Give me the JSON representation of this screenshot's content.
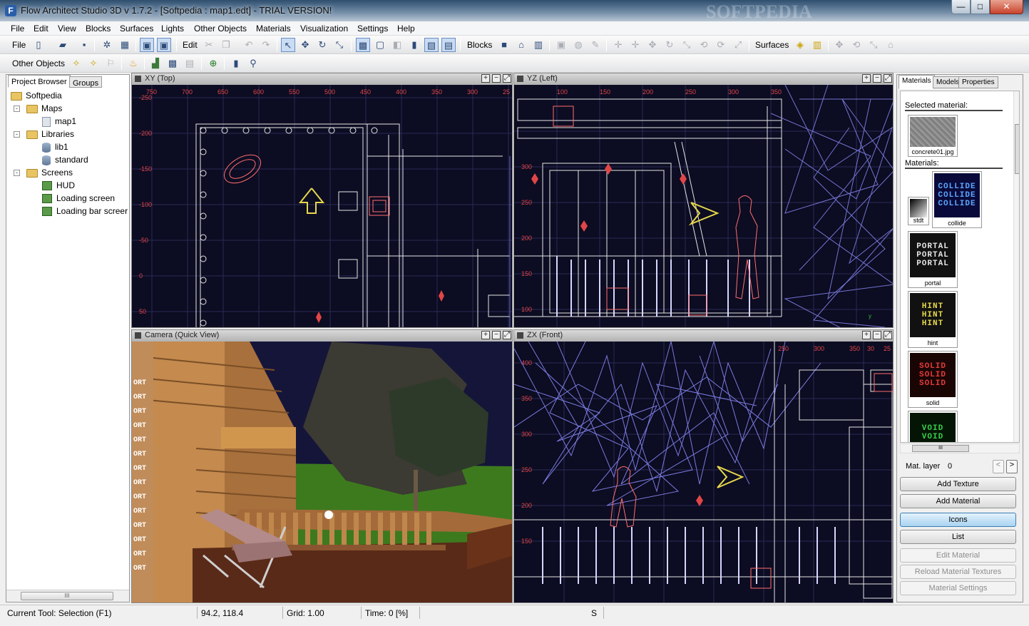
{
  "window": {
    "title": "Flow Architect Studio 3D v 1.7.2  - [Softpedia : map1.edt]  - TRIAL VERSION!",
    "watermark": "SOFTPEDIA",
    "app_icon": "F",
    "min_label": "—",
    "max_label": "□",
    "close_label": "✕"
  },
  "menu": [
    "File",
    "Edit",
    "View",
    "Blocks",
    "Surfaces",
    "Lights",
    "Other Objects",
    "Materials",
    "Visualization",
    "Settings",
    "Help"
  ],
  "toolbar1": {
    "file_label": "File",
    "edit_label": "Edit",
    "blocks_label": "Blocks",
    "surfaces_label": "Surfaces"
  },
  "toolbar2": {
    "other_objects_label": "Other Objects"
  },
  "left_panel": {
    "tabs": [
      "Project Browser",
      "Groups"
    ],
    "tree": [
      {
        "label": "Softpedia",
        "level": 0,
        "icon": "folder-icon"
      },
      {
        "label": "Maps",
        "level": 1,
        "icon": "folder-icon",
        "expander": "-"
      },
      {
        "label": "map1",
        "level": 2,
        "icon": "map-file-icon"
      },
      {
        "label": "Libraries",
        "level": 1,
        "icon": "folder-icon",
        "expander": "-"
      },
      {
        "label": "lib1",
        "level": 2,
        "icon": "library-icon"
      },
      {
        "label": "standard",
        "level": 2,
        "icon": "library-icon"
      },
      {
        "label": "Screens",
        "level": 1,
        "icon": "folder-icon",
        "expander": "-"
      },
      {
        "label": "HUD",
        "level": 2,
        "icon": "screen-icon"
      },
      {
        "label": "Loading screen",
        "level": 2,
        "icon": "screen-icon"
      },
      {
        "label": "Loading bar screer",
        "level": 2,
        "icon": "screen-icon"
      }
    ],
    "scroll_thumb": "III"
  },
  "viewports": {
    "xy": {
      "title": "XY (Top)",
      "top_ticks": [
        "750",
        "700",
        "650",
        "600",
        "550",
        "500",
        "450",
        "400",
        "350",
        "300",
        "25"
      ],
      "side_ticks": [
        "-250",
        "-200",
        "-150",
        "-100",
        "-50",
        "0",
        "50"
      ]
    },
    "yz": {
      "title": "YZ (Left)",
      "top_ticks": [
        "100",
        "150",
        "200",
        "250",
        "300",
        "350"
      ],
      "side_ticks": [
        "300",
        "250",
        "200",
        "150",
        "100"
      ],
      "axis_label": "y"
    },
    "camera": {
      "title": "Camera (Quick View)",
      "sign_text": "ORT"
    },
    "zx": {
      "title": "ZX (Front)",
      "top_ticks": [
        "250",
        "300",
        "350",
        "30",
        "25"
      ],
      "side_ticks": [
        "400",
        "350",
        "300",
        "250",
        "200",
        "150"
      ]
    }
  },
  "viewport_controls": {
    "plus": "+",
    "minus": "−",
    "maximize": "⤢"
  },
  "right_panel": {
    "tabs": [
      "Materials",
      "Models",
      "Properties"
    ],
    "selected_label": "Selected material:",
    "selected_name": "concrete01.jpg",
    "materials_label": "Materials:",
    "materials": [
      {
        "name": "stdt",
        "lines": [],
        "color": "#888888"
      },
      {
        "name": "collide",
        "lines": [
          "COLLIDE",
          "COLLIDE",
          "COLLIDE"
        ],
        "color": "#5aa8ff"
      },
      {
        "name": "portal",
        "lines": [
          "PORTAL",
          "PORTAL",
          "PORTAL"
        ],
        "color": "#e6e6e6"
      },
      {
        "name": "hint",
        "lines": [
          "HINT",
          "HINT",
          "HINT"
        ],
        "color": "#e6d84a"
      },
      {
        "name": "solid",
        "lines": [
          "SOLID",
          "SOLID",
          "SOLID"
        ],
        "color": "#e63a3a"
      },
      {
        "name": "void",
        "lines": [
          "VOID",
          "VOID"
        ],
        "color": "#34d34a"
      }
    ],
    "scroll_thumb": "III",
    "mat_layer_label": "Mat. layer",
    "mat_layer_value": "0",
    "prev": "<",
    "next": ">",
    "buttons": [
      {
        "label": "Add Texture",
        "state": "normal"
      },
      {
        "label": "Add Material",
        "state": "normal"
      },
      {
        "label": "Icons",
        "state": "selected"
      },
      {
        "label": "List",
        "state": "normal"
      },
      {
        "label": "Edit Material",
        "state": "disabled"
      },
      {
        "label": "Reload Material Textures",
        "state": "disabled"
      },
      {
        "label": "Material Settings",
        "state": "disabled"
      }
    ]
  },
  "status": {
    "tool": "Current Tool:  Selection (F1)",
    "coords": "94.2, 118.4",
    "grid": "Grid: 1.00",
    "time": "Time: 0 [%]",
    "snap": "S"
  }
}
